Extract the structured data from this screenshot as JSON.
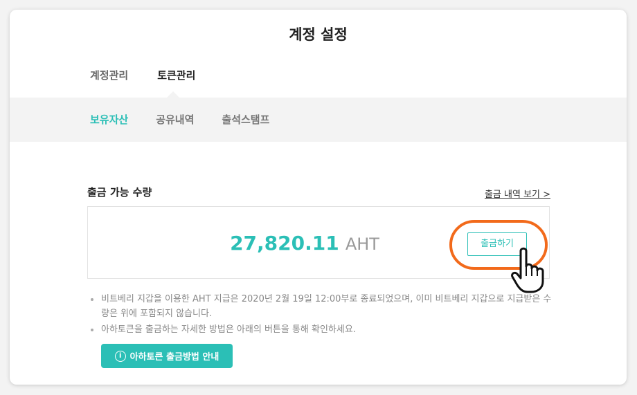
{
  "page": {
    "title": "계정 설정"
  },
  "top_tabs": [
    {
      "label": "계정관리",
      "active": false
    },
    {
      "label": "토큰관리",
      "active": true
    }
  ],
  "sub_tabs": [
    {
      "label": "보유자산",
      "active": true
    },
    {
      "label": "공유내역",
      "active": false
    },
    {
      "label": "출석스탬프",
      "active": false
    }
  ],
  "withdrawable": {
    "label": "출금 가능 수량",
    "history_link": "출금 내역 보기 >",
    "amount": "27,820.11",
    "unit": "AHT",
    "withdraw_button": "출금하기"
  },
  "notes": [
    "비트베리 지갑을 이용한 AHT 지급은 2020년 2월 19일 12:00부로 종료되었으며, 이미 비트베리 지갑으로 지급받은 수량은 위에 포함되지 않습니다.",
    "아하토큰을 출금하는 자세한 방법은 아래의 버튼을 통해 확인하세요."
  ],
  "guide_button": {
    "icon": "info-icon",
    "label": "아하토큰 출금방법 안내"
  },
  "colors": {
    "accent": "#2bbfb6",
    "highlight": "#f26a1b"
  }
}
